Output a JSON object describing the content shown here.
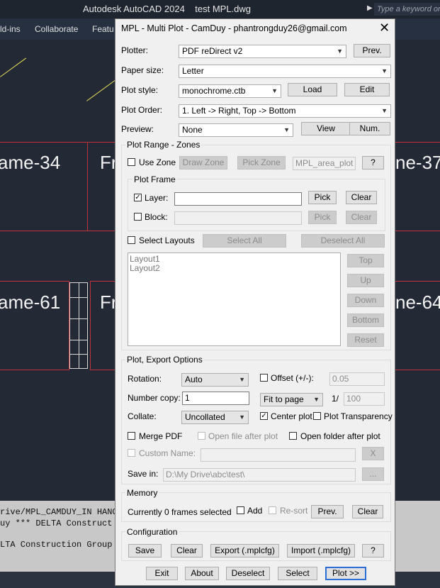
{
  "app": {
    "title": "Autodesk AutoCAD 2024    test MPL.dwg",
    "search_placeholder": "Type a keyword or",
    "ribbon_tabs": [
      "ld-ins",
      "Collaborate",
      "Featu"
    ]
  },
  "drawing": {
    "frames": [
      "ame-34",
      "Fr",
      "ne-37",
      "ame-61",
      "Fr",
      "ne-64"
    ]
  },
  "command_lines": [
    "rive/MPL_CAMDUY_IN HANG",
    "uy *** DELTA Construct",
    "",
    "LTA Construction Group C"
  ],
  "dialog": {
    "title": "MPL - Multi Plot - CamDuy - phantrongduy26@gmail.com",
    "close": "✕",
    "plotter": {
      "label": "Plotter:",
      "value": "PDF reDirect v2",
      "prev": "Prev."
    },
    "paper_size": {
      "label": "Paper size:",
      "value": "Letter"
    },
    "plot_style": {
      "label": "Plot style:",
      "value": "monochrome.ctb",
      "load": "Load",
      "edit": "Edit"
    },
    "plot_order": {
      "label": "Plot Order:",
      "value": "1. Left -> Right, Top -> Bottom"
    },
    "preview": {
      "label": "Preview:",
      "value": "None",
      "view": "View",
      "num": "Num."
    },
    "range": {
      "title": "Plot Range - Zones",
      "use_zone": "Use Zone",
      "draw_zone": "Draw Zone",
      "pick_zone": "Pick Zone",
      "zone_layer": "MPL_area_plot",
      "help": "?",
      "frame_title": "Plot Frame",
      "layer": {
        "label": "Layer:",
        "checked": true,
        "value": "",
        "pick": "Pick",
        "clear": "Clear"
      },
      "block": {
        "label": "Block:",
        "checked": false,
        "value": "",
        "pick": "Pick",
        "clear": "Clear"
      },
      "select_layouts": "Select Layouts",
      "select_all": "Select All",
      "deselect_all": "Deselect All",
      "layouts": [
        "Layout1",
        "Layout2"
      ],
      "order_buttons": [
        "Top",
        "Up",
        "Down",
        "Bottom",
        "Reset"
      ]
    },
    "options": {
      "title": "Plot, Export Options",
      "rotation": {
        "label": "Rotation:",
        "value": "Auto"
      },
      "offset": {
        "label": "Offset (+/-):",
        "checked": false,
        "value": "0.05"
      },
      "copies": {
        "label": "Number copy:",
        "value": "1"
      },
      "scale": {
        "value": "Fit to page",
        "sep": "1/",
        "denominator": "100"
      },
      "collate": {
        "label": "Collate:",
        "value": "Uncollated"
      },
      "center_plot": {
        "label": "Center plot",
        "checked": true
      },
      "transparency": {
        "label": "Plot Transparency",
        "checked": false
      },
      "merge_pdf": {
        "label": "Merge PDF",
        "checked": false
      },
      "open_file": {
        "label": "Open file after plot",
        "checked": false
      },
      "open_folder": {
        "label": "Open folder after plot",
        "checked": false
      },
      "custom_name": {
        "label": "Custom Name:",
        "value": "",
        "clear": "X"
      },
      "save_in": {
        "label": "Save in:",
        "value": "D:\\My Drive\\abc\\test\\",
        "browse": "..."
      }
    },
    "memory": {
      "title": "Memory",
      "status": "Currently 0 frames selected",
      "add": "Add",
      "resort": "Re-sort",
      "prev": "Prev.",
      "clear": "Clear"
    },
    "config": {
      "title": "Configuration",
      "save": "Save",
      "clear": "Clear",
      "export": "Export (.mplcfg)",
      "import": "Import (.mplcfg)",
      "help": "?"
    },
    "footer": {
      "exit": "Exit",
      "about": "About",
      "deselect": "Deselect",
      "select": "Select",
      "plot": "Plot >>"
    }
  }
}
